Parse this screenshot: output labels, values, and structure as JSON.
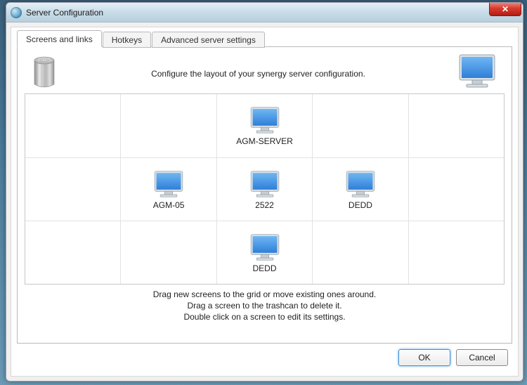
{
  "window": {
    "title": "Server Configuration"
  },
  "tabs": [
    {
      "label": "Screens and links",
      "active": true
    },
    {
      "label": "Hotkeys"
    },
    {
      "label": "Advanced server settings"
    }
  ],
  "header": {
    "caption": "Configure the layout of your synergy server configuration."
  },
  "grid": {
    "cells": {
      "r0c2": "AGM-SERVER",
      "r1c1": "AGM-05",
      "r1c2": "2522",
      "r1c3": "DEDD",
      "r2c2": "DEDD"
    }
  },
  "hints": {
    "line1": "Drag new screens to the grid or move existing ones around.",
    "line2": "Drag a screen to the trashcan to delete it.",
    "line3": "Double click on a screen to edit its settings."
  },
  "buttons": {
    "ok": "OK",
    "cancel": "Cancel"
  }
}
